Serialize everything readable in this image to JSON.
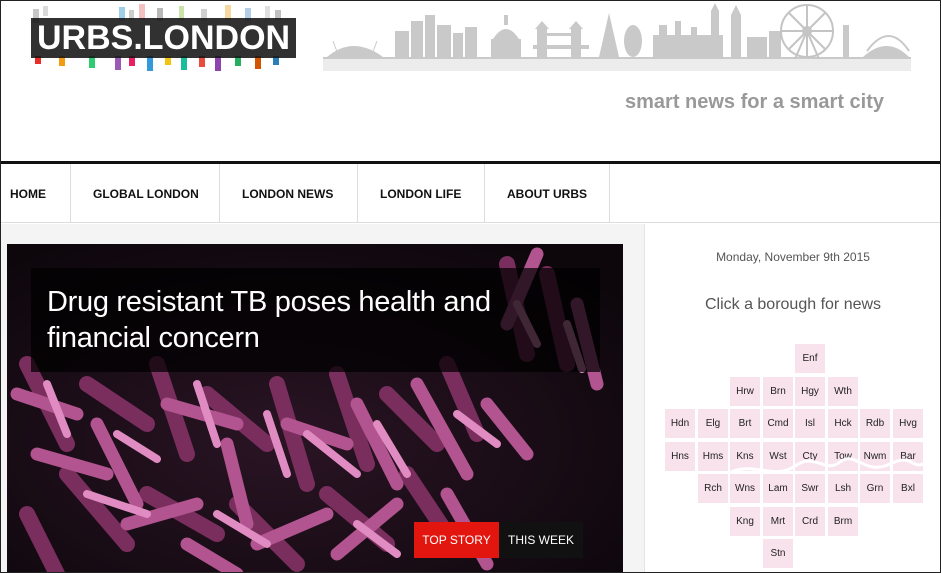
{
  "header": {
    "logo_text": "URBS.LONDON",
    "tagline": "smart news for a smart city"
  },
  "nav": {
    "items": [
      "HOME",
      "GLOBAL LONDON",
      "LONDON NEWS",
      "LONDON LIFE",
      "ABOUT URBS"
    ]
  },
  "hero": {
    "headline": "Drug resistant TB poses health and financial concern",
    "tag_top_story": "TOP STORY",
    "tag_this_week": "THIS WEEK"
  },
  "sidebar": {
    "date": "Monday, November 9th 2015",
    "borough_title": "Click a borough for news",
    "boroughs": [
      [
        "",
        "",
        "",
        "",
        "Enf",
        "",
        "",
        ""
      ],
      [
        "",
        "",
        "Hrw",
        "Brn",
        "Hgy",
        "Wth",
        "",
        ""
      ],
      [
        "Hdn",
        "Elg",
        "Brt",
        "Cmd",
        "Isl",
        "Hck",
        "Rdb",
        "Hvg"
      ],
      [
        "Hns",
        "Hms",
        "Kns",
        "Wst",
        "Cty",
        "Tow",
        "Nwm",
        "Bar"
      ],
      [
        "",
        "Rch",
        "Wns",
        "Lam",
        "Swr",
        "Lsh",
        "Grn",
        "Bxl"
      ],
      [
        "",
        "",
        "Kng",
        "Mrt",
        "Crd",
        "Brm",
        "",
        ""
      ],
      [
        "",
        "",
        "",
        "Stn",
        "",
        "",
        "",
        ""
      ]
    ]
  },
  "colors": {
    "nav_border": "#dddddd",
    "tag_top_story": "#e3150f",
    "tag_this_week": "#111111",
    "borough_cell": "#f8e3ec",
    "tagline": "#999999"
  }
}
